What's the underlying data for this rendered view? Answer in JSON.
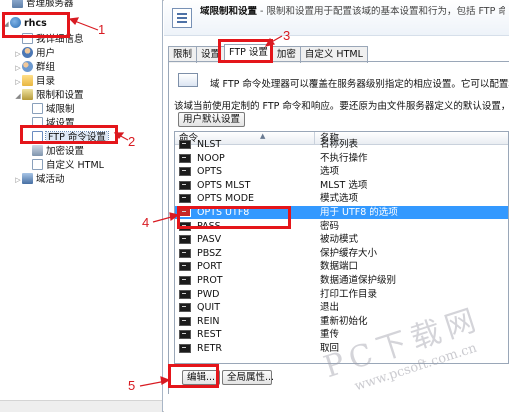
{
  "tree": {
    "items": [
      {
        "label": "管理服务器",
        "icon": "server-icon"
      },
      {
        "label": "rhcs",
        "icon": "globe-icon"
      },
      {
        "label": "我详细信息",
        "icon": "page-icon"
      },
      {
        "label": "用户",
        "icon": "user-icon"
      },
      {
        "label": "群组",
        "icon": "group-icon"
      },
      {
        "label": "目录",
        "icon": "folder-icon"
      },
      {
        "label": "限制和设置",
        "icon": "lock-icon"
      },
      {
        "label": "域限制",
        "icon": "page-icon"
      },
      {
        "label": "域设置",
        "icon": "page-icon"
      },
      {
        "label": "FTP 命令设置",
        "icon": "ftp-icon"
      },
      {
        "label": "加密设置",
        "icon": "key-icon"
      },
      {
        "label": "自定义 HTML",
        "icon": "page-icon"
      },
      {
        "label": "域活动",
        "icon": "activity-icon"
      }
    ]
  },
  "header": {
    "title": "域限制和设置",
    "description": " - 限制和设置用于配置该域的基本设置和行为，包括 FTP 命"
  },
  "tabs": [
    "限制",
    "设置",
    "FTP 设置",
    "加密",
    "自定义 HTML"
  ],
  "active_tab": "FTP 设置",
  "info_text": "域 FTP 命令处理器可以覆盖在服务器级别指定的相应设置。它可以配置和",
  "description_text": "该域当前使用定制的 FTP 命令和响应。要还原为由文件服务器定义的默认设置，",
  "user_default_button": "用户默认设置",
  "columns": {
    "command": "命令",
    "description": "名称"
  },
  "commands": [
    {
      "cmd": "NLST",
      "desc": "名称列表"
    },
    {
      "cmd": "NOOP",
      "desc": "不执行操作"
    },
    {
      "cmd": "OPTS",
      "desc": "选项"
    },
    {
      "cmd": "OPTS MLST",
      "desc": "MLST 选项"
    },
    {
      "cmd": "OPTS MODE",
      "desc": "模式选项"
    },
    {
      "cmd": "OPTS UTF8",
      "desc": "用于 UTF8 的选项"
    },
    {
      "cmd": "PASS",
      "desc": "密码"
    },
    {
      "cmd": "PASV",
      "desc": "被动模式"
    },
    {
      "cmd": "PBSZ",
      "desc": "保护缓存大小"
    },
    {
      "cmd": "PORT",
      "desc": "数据端口"
    },
    {
      "cmd": "PROT",
      "desc": "数据通道保护级别"
    },
    {
      "cmd": "PWD",
      "desc": "打印工作目录"
    },
    {
      "cmd": "QUIT",
      "desc": "退出"
    },
    {
      "cmd": "REIN",
      "desc": "重新初始化"
    },
    {
      "cmd": "REST",
      "desc": "重传"
    },
    {
      "cmd": "RETR",
      "desc": "取回"
    }
  ],
  "selected_command": "OPTS UTF8",
  "buttons": {
    "edit": "编辑...",
    "global": "全局属性..."
  },
  "annotations": [
    "1",
    "2",
    "3",
    "4",
    "5"
  ],
  "watermark": {
    "text": "PC下载网",
    "url": "www.pcsoft.com.cn"
  },
  "colors": {
    "annotation": "#e4151a",
    "selection": "#3399ff"
  }
}
